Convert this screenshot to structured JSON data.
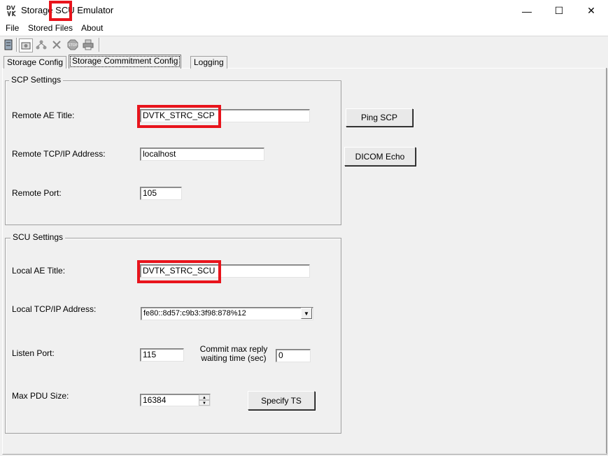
{
  "window": {
    "title_prefix": "Storage ",
    "title_highlight": "SCU",
    "title_suffix": " Emulator",
    "minimize": "—",
    "maximize": "☐",
    "close": "✕"
  },
  "menu": [
    "File",
    "Stored Files",
    "About"
  ],
  "toolbar": {
    "icons": [
      "storage-db-icon",
      "config-icon",
      "network-icon",
      "close-x-icon",
      "stop-icon",
      "print-icon"
    ]
  },
  "tabs": [
    "Storage Config",
    "Storage Commitment Config",
    "Logging"
  ],
  "scp": {
    "legend": "SCP Settings",
    "remote_ae_label": "Remote AE Title:",
    "remote_ae_value": "DVTK_STRC_SCP",
    "remote_ip_label": "Remote TCP/IP Address:",
    "remote_ip_value": "localhost",
    "remote_port_label": "Remote Port:",
    "remote_port_value": "105",
    "ping_button": "Ping SCP",
    "echo_button": "DICOM Echo"
  },
  "scu": {
    "legend": "SCU Settings",
    "local_ae_label": "Local AE Title:",
    "local_ae_value": "DVTK_STRC_SCU",
    "local_ip_label": "Local TCP/IP Address:",
    "local_ip_value": "fe80::8d57:c9b3:3f98:878%12",
    "listen_port_label": "Listen Port:",
    "listen_port_value": "115",
    "commit_label_1": "Commit max reply",
    "commit_label_2": "waiting time (sec)",
    "commit_value": "0",
    "max_pdu_label": "Max PDU Size:",
    "max_pdu_value": "16384",
    "specify_ts_button": "Specify TS"
  },
  "colors": {
    "highlight": "#e8141c",
    "background": "#f0f0f0"
  }
}
